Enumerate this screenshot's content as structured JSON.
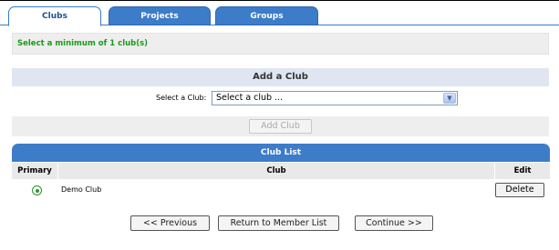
{
  "tabs": [
    {
      "label": "Clubs",
      "active": true
    },
    {
      "label": "Projects",
      "active": false
    },
    {
      "label": "Groups",
      "active": false
    }
  ],
  "message": "Select a minimum of 1 club(s)",
  "add_club": {
    "header": "Add a Club",
    "select_label": "Select a Club:",
    "select_value": "Select a club ...",
    "button_label": "Add Club"
  },
  "club_list": {
    "header": "Club List",
    "columns": [
      "Primary",
      "Club",
      "Edit"
    ],
    "rows": [
      {
        "primary": true,
        "club": "Demo Club",
        "action": "Delete"
      }
    ]
  },
  "footer": {
    "previous": "<< Previous",
    "return": "Return to Member List",
    "continue": "Continue >>"
  },
  "colors": {
    "tab_blue": "#3d7cc9",
    "message_green": "#1a9a1a",
    "panel_header_bg": "#dfe6f1"
  },
  "icons": {
    "select_arrow": "chevron-down-icon",
    "primary_radio": "radio-selected-icon"
  }
}
